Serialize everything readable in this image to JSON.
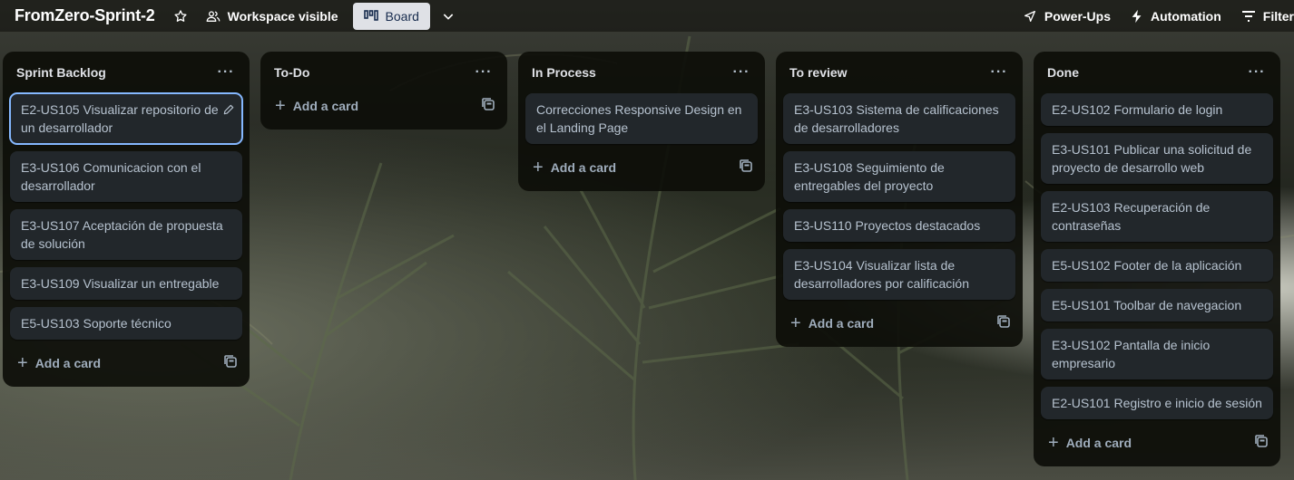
{
  "header": {
    "board_title": "FromZero-Sprint-2",
    "visibility_label": "Workspace visible",
    "view_label": "Board",
    "power_ups_label": "Power-Ups",
    "automation_label": "Automation",
    "filter_label": "Filter"
  },
  "lists": [
    {
      "title": "Sprint Backlog",
      "menu": "···",
      "add_label": "Add a card",
      "cards": [
        "E2-US105 Visualizar repositorio de un desarrollador",
        "E3-US106 Comunicacion con el desarrollador",
        "E3-US107 Aceptación de propuesta de solución",
        "E3-US109 Visualizar un entregable",
        "E5-US103 Soporte técnico"
      ]
    },
    {
      "title": "To-Do",
      "menu": "···",
      "add_label": "Add a card",
      "cards": []
    },
    {
      "title": "In Process",
      "menu": "···",
      "add_label": "Add a card",
      "cards": [
        "Correcciones Responsive Design en el Landing Page"
      ]
    },
    {
      "title": "To review",
      "menu": "···",
      "add_label": "Add a card",
      "cards": [
        "E3-US103 Sistema de calificaciones de desarrolladores",
        "E3-US108 Seguimiento de entregables del proyecto",
        "E3-US110 Proyectos destacados",
        "E3-US104 Visualizar lista de desarrolladores por calificación"
      ]
    },
    {
      "title": "Done",
      "menu": "···",
      "add_label": "Add a card",
      "cards": [
        "E2-US102 Formulario de login",
        "E3-US101 Publicar una solicitud de proyecto de desarrollo web",
        "E2-US103 Recuperación de contraseñas",
        "E5-US102 Footer de la aplicación",
        "E5-US101 Toolbar de navegacion",
        "E3-US102 Pantalla de inicio empresario",
        "E2-US101 Registro e inicio de sesión"
      ]
    }
  ],
  "colors": {
    "list_bg": "#0d0e09",
    "card_bg": "#22272b",
    "card_text": "#b6c2cf",
    "selected_outline": "#85b8ff",
    "board_tab_bg": "#dfe1e6"
  }
}
